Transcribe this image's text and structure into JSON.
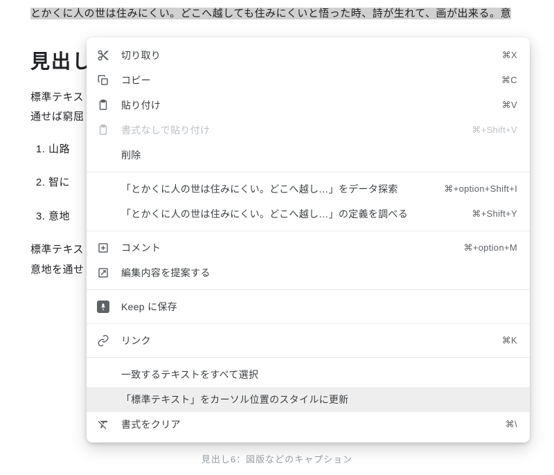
{
  "document": {
    "para1_selected": "とかくに人の世は住みにくい。どこへ越しても住みにくいと悟った時、詩が生れて、画が出来る。",
    "para1_tail": "意",
    "heading": "見出し",
    "para2_line1": "標準テキス",
    "para2_line2": "通せば窮屈",
    "ol_items": [
      "山路",
      "智に",
      "意地"
    ],
    "para3_line1": "標準テキス",
    "para3_line2": "意地を通せ",
    "caption": "見出し6：図版などのキャプション"
  },
  "menu": {
    "cut": {
      "label": "切り取り",
      "shortcut": "⌘X"
    },
    "copy": {
      "label": "コピー",
      "shortcut": "⌘C"
    },
    "paste": {
      "label": "貼り付け",
      "shortcut": "⌘V"
    },
    "paste_plain": {
      "label": "書式なしで貼り付け",
      "shortcut": "⌘+Shift+V"
    },
    "delete": {
      "label": "削除"
    },
    "explore": {
      "label": "「とかくに人の世は住みにくい。どこへ越し…」をデータ探索",
      "shortcut": "⌘+option+Shift+I"
    },
    "define": {
      "label": "「とかくに人の世は住みにくい。どこへ越し…」の定義を調べる",
      "shortcut": "⌘+Shift+Y"
    },
    "comment": {
      "label": "コメント",
      "shortcut": "⌘+option+M"
    },
    "suggest": {
      "label": "編集内容を提案する"
    },
    "keep": {
      "label": "Keep に保存"
    },
    "link": {
      "label": "リンク",
      "shortcut": "⌘K"
    },
    "select_matching": {
      "label": "一致するテキストをすべて選択"
    },
    "update_style": {
      "label": "「標準テキスト」をカーソル位置のスタイルに更新"
    },
    "clear_format": {
      "label": "書式をクリア",
      "shortcut": "⌘\\"
    }
  }
}
